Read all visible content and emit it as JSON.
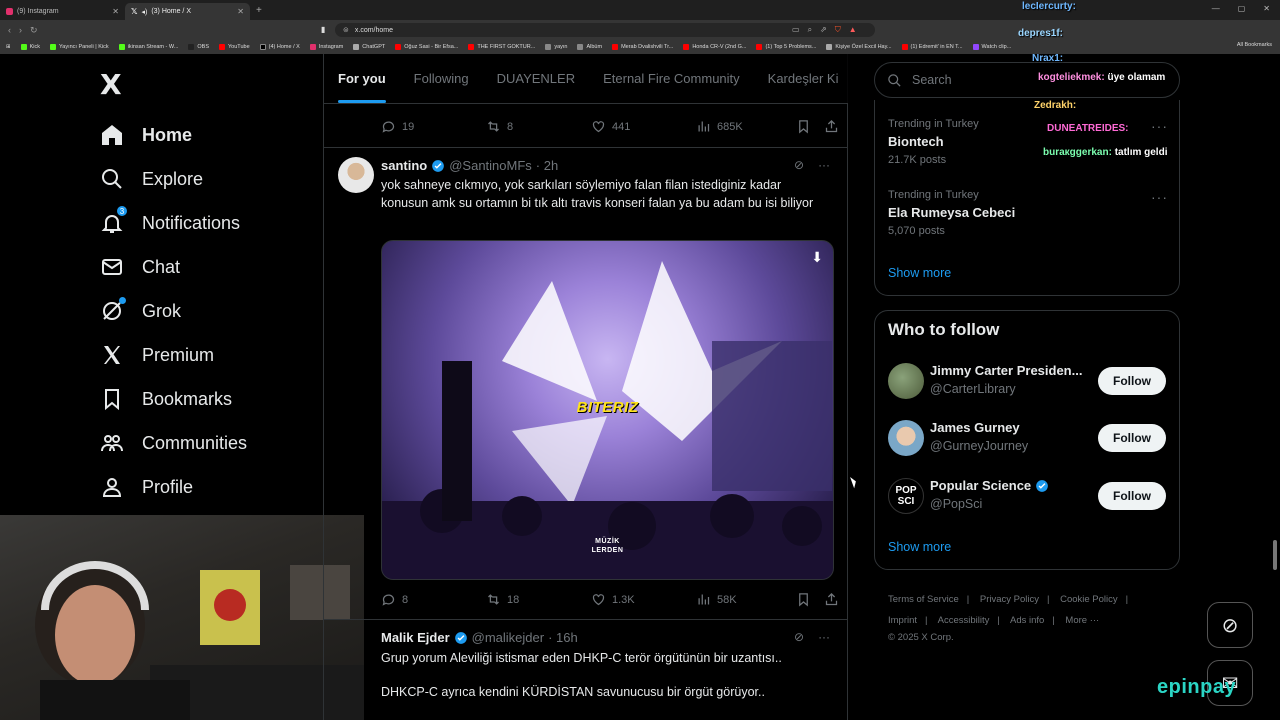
{
  "browser": {
    "tabs": [
      {
        "title": "(9) Instagram",
        "active": false
      },
      {
        "title": "(3) Home / X",
        "active": true
      }
    ],
    "url": "x.com/home",
    "bookmarks": [
      "Kick",
      "Yayıncı Paneli | Kick",
      "ikinsan Stream - W...",
      "OBS",
      "YouTube",
      "(4) Home / X",
      "Instagram",
      "ChatGPT",
      "Oğuz Sasi - Bir Efsa...",
      "THE FIRST GOKTUR...",
      "yayın",
      "Albüm",
      "Merab Dvalishvili Tr...",
      "Honda CR-V (2nd G...",
      "(1) Top 5 Problems...",
      "Kişiye Özel Excil Hay...",
      "(1) Edremit' in EN T...",
      "Watch clip...",
      "All Bookmarks"
    ]
  },
  "sidebar": {
    "logo": "X",
    "items": [
      {
        "label": "Home",
        "icon": "home-icon",
        "active": true
      },
      {
        "label": "Explore",
        "icon": "search-icon"
      },
      {
        "label": "Notifications",
        "icon": "bell-icon",
        "badge": "3"
      },
      {
        "label": "Chat",
        "icon": "mail-icon"
      },
      {
        "label": "Grok",
        "icon": "grok-icon",
        "dot": true
      },
      {
        "label": "Premium",
        "icon": "x-premium-icon"
      },
      {
        "label": "Bookmarks",
        "icon": "bookmark-icon"
      },
      {
        "label": "Communities",
        "icon": "communities-icon"
      },
      {
        "label": "Profile",
        "icon": "profile-icon"
      }
    ]
  },
  "feed": {
    "tabs": [
      "For you",
      "Following",
      "DUAYENLER",
      "Eternal Fire Community",
      "Kardeşler Ki"
    ],
    "top_actions": {
      "replies": "19",
      "reposts": "8",
      "likes": "441",
      "views": "685K"
    },
    "tweet1": {
      "name": "santino",
      "handle": "@SantinoMFs",
      "time": "· 2h",
      "text": "yok sahneye cıkmıyo, yok sarkıları söylemiyo falan filan istediginiz kadar konusun amk su ortamın bi tık altı travis konseri falan ya bu adam bu isi biliyor",
      "media_caption": "BITERIZ",
      "media_watermark_1": "MÜZİK",
      "media_watermark_2": "LERDEN",
      "replies": "8",
      "reposts": "18",
      "likes": "1.3K",
      "views": "58K"
    },
    "tweet2": {
      "name": "Malik Ejder",
      "handle": "@malikejder",
      "time": "· 16h",
      "line1": "Grup yorum Aleviliği istismar eden DHKP-C terör örgütünün bir uzantısı..",
      "line2": "DHKCP-C ayrıca kendini KÜRDİSTAN savunucusu bir örgüt görüyor.."
    }
  },
  "right": {
    "search_placeholder": "Search",
    "trends": [
      {
        "category": "Trending in Turkey",
        "title": "Biontech",
        "count": "21.7K posts"
      },
      {
        "category": "Trending in Turkey",
        "title": "Ela Rumeysa Cebeci",
        "count": "5,070 posts"
      }
    ],
    "show_more": "Show more",
    "who_to_follow": "Who to follow",
    "follow": [
      {
        "name": "Jimmy Carter Presiden...",
        "handle": "@CarterLibrary",
        "button": "Follow"
      },
      {
        "name": "James Gurney",
        "handle": "@GurneyJourney",
        "button": "Follow"
      },
      {
        "name": "Popular Science",
        "handle": "@PopSci",
        "button": "Follow",
        "verified": true,
        "avatar_text": "POP SCI"
      }
    ],
    "footer": {
      "links1": [
        "Terms of Service",
        "Privacy Policy",
        "Cookie Policy"
      ],
      "links2": [
        "Imprint",
        "Accessibility",
        "Ads info",
        "More ···"
      ],
      "copyright": "© 2025 X Corp."
    }
  },
  "overlay": {
    "chat": [
      {
        "user": "lecIercurty:",
        "msg": "",
        "color": "#6fb8ff"
      },
      {
        "user": "depres1f:",
        "msg": "",
        "color": "#9ad6ff"
      },
      {
        "user": "Nrax1:",
        "msg": "",
        "color": "#6fb8ff"
      },
      {
        "user": "kogteliekmek:",
        "msg": "üye olamam",
        "color": "#ff8fe0"
      },
      {
        "user": "Zedrakh:",
        "msg": "",
        "color": "#ffd36a"
      },
      {
        "user": "DUNEATREIDES:",
        "msg": "",
        "color": "#ff6ad5"
      },
      {
        "user": "buraкggerkan:",
        "msg": "tatlım geldi",
        "color": "#7cffb0"
      }
    ],
    "sponsor": "epinpay"
  }
}
